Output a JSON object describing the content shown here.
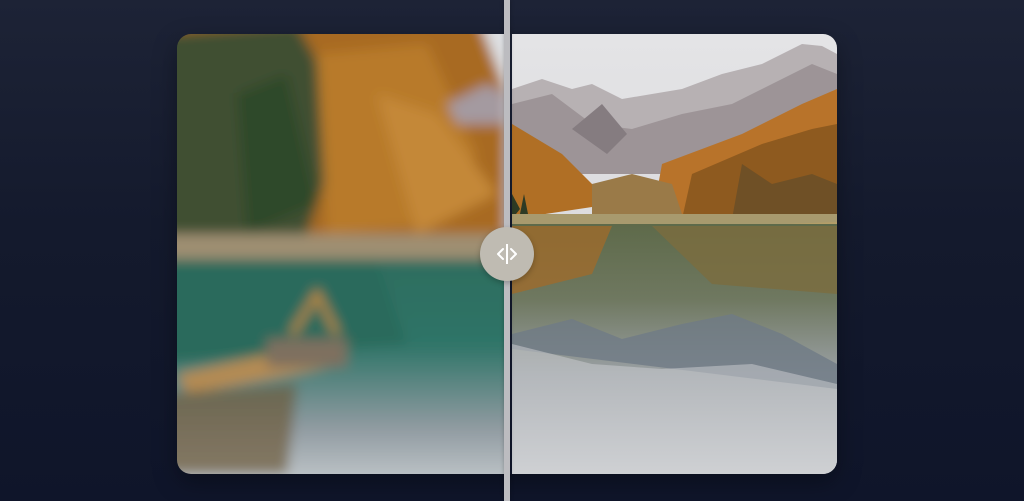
{
  "comparison": {
    "before": {
      "label": "",
      "description_icon": "blurred-lake-photo"
    },
    "after": {
      "label": "",
      "description_icon": "sharp-lake-photo"
    },
    "slider": {
      "position": 0.5,
      "icon": "split-arrows-icon"
    }
  },
  "colors": {
    "background_top": "#1d2336",
    "background_bottom": "#0f152a",
    "divider": "#bcbcc0",
    "handle": "#bfbbb2"
  }
}
